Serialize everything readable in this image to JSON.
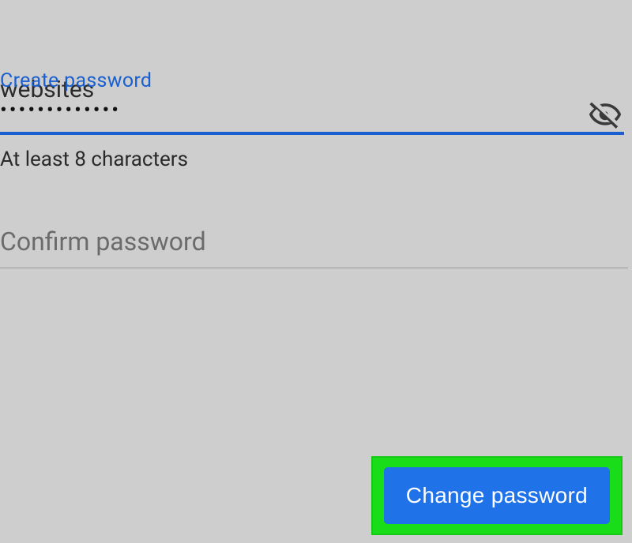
{
  "description_fragment": "websites",
  "create_password": {
    "label": "Create password",
    "masked_value": "•••••••••••••",
    "helper": "At least 8 characters"
  },
  "confirm_password": {
    "placeholder": "Confirm password"
  },
  "button": {
    "label": "Change password"
  },
  "icons": {
    "visibility_off": "visibility-off-icon"
  }
}
